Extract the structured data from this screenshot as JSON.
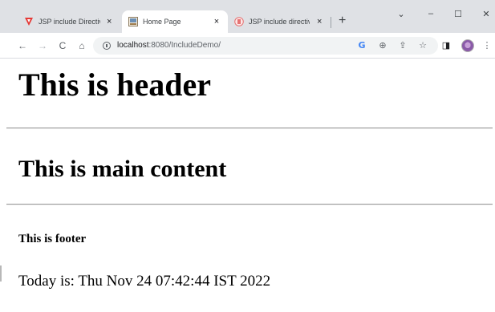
{
  "browser": {
    "tabs": [
      {
        "title": "JSP include Directiv",
        "icon": "red-triangle-logo-icon",
        "active": false
      },
      {
        "title": "Home Page",
        "icon": "page-favicon-icon",
        "active": true
      },
      {
        "title": "JSP include directiv",
        "icon": "jsp-favicon-icon",
        "active": false
      }
    ],
    "close_glyph": "×",
    "new_tab_glyph": "+",
    "window_controls": {
      "dropdown": "⌄",
      "minimize": "–",
      "maximize": "☐",
      "close": "✕"
    },
    "nav": {
      "back": "←",
      "forward": "→",
      "reload": "C",
      "home": "⌂"
    },
    "url": {
      "host": "localhost",
      "rest": ":8080/IncludeDemo/"
    },
    "toolbar_icons": [
      "google-icon",
      "zoom-icon",
      "share-icon",
      "bookmark-star-icon",
      "sidepanel-icon",
      "profile-avatar-icon",
      "menu-kebab-icon"
    ],
    "toolbar_glyphs": {
      "google": "G",
      "zoom": "⊕",
      "share": "⇪",
      "star": "☆",
      "sidepanel": "◨",
      "menu": "⋮"
    }
  },
  "page": {
    "header": "This is header",
    "main": "This is main content",
    "footer": "This is footer",
    "today": "Today is: Thu Nov 24 07:42:44 IST 2022"
  }
}
